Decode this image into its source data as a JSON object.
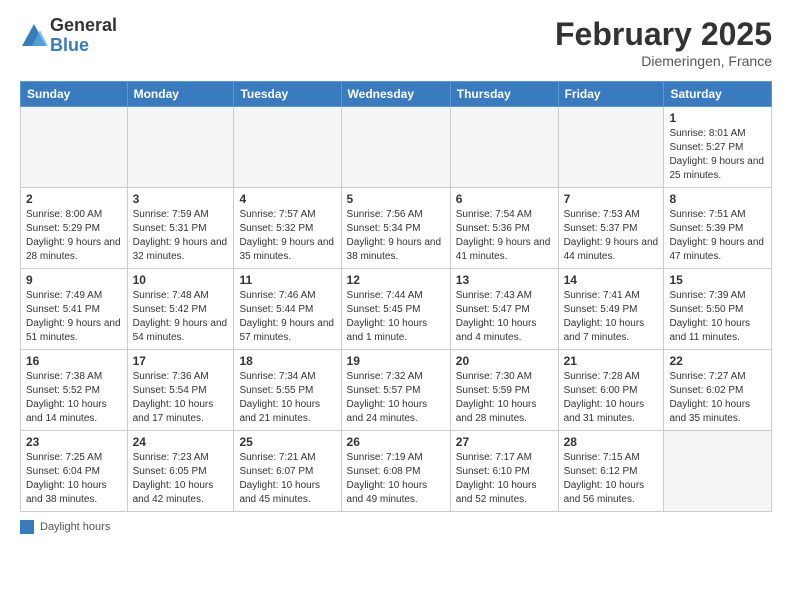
{
  "logo": {
    "general": "General",
    "blue": "Blue"
  },
  "title": "February 2025",
  "subtitle": "Diemeringen, France",
  "days_of_week": [
    "Sunday",
    "Monday",
    "Tuesday",
    "Wednesday",
    "Thursday",
    "Friday",
    "Saturday"
  ],
  "weeks": [
    [
      {
        "day": "",
        "info": ""
      },
      {
        "day": "",
        "info": ""
      },
      {
        "day": "",
        "info": ""
      },
      {
        "day": "",
        "info": ""
      },
      {
        "day": "",
        "info": ""
      },
      {
        "day": "",
        "info": ""
      },
      {
        "day": "1",
        "info": "Sunrise: 8:01 AM\nSunset: 5:27 PM\nDaylight: 9 hours and 25 minutes."
      }
    ],
    [
      {
        "day": "2",
        "info": "Sunrise: 8:00 AM\nSunset: 5:29 PM\nDaylight: 9 hours and 28 minutes."
      },
      {
        "day": "3",
        "info": "Sunrise: 7:59 AM\nSunset: 5:31 PM\nDaylight: 9 hours and 32 minutes."
      },
      {
        "day": "4",
        "info": "Sunrise: 7:57 AM\nSunset: 5:32 PM\nDaylight: 9 hours and 35 minutes."
      },
      {
        "day": "5",
        "info": "Sunrise: 7:56 AM\nSunset: 5:34 PM\nDaylight: 9 hours and 38 minutes."
      },
      {
        "day": "6",
        "info": "Sunrise: 7:54 AM\nSunset: 5:36 PM\nDaylight: 9 hours and 41 minutes."
      },
      {
        "day": "7",
        "info": "Sunrise: 7:53 AM\nSunset: 5:37 PM\nDaylight: 9 hours and 44 minutes."
      },
      {
        "day": "8",
        "info": "Sunrise: 7:51 AM\nSunset: 5:39 PM\nDaylight: 9 hours and 47 minutes."
      }
    ],
    [
      {
        "day": "9",
        "info": "Sunrise: 7:49 AM\nSunset: 5:41 PM\nDaylight: 9 hours and 51 minutes."
      },
      {
        "day": "10",
        "info": "Sunrise: 7:48 AM\nSunset: 5:42 PM\nDaylight: 9 hours and 54 minutes."
      },
      {
        "day": "11",
        "info": "Sunrise: 7:46 AM\nSunset: 5:44 PM\nDaylight: 9 hours and 57 minutes."
      },
      {
        "day": "12",
        "info": "Sunrise: 7:44 AM\nSunset: 5:45 PM\nDaylight: 10 hours and 1 minute."
      },
      {
        "day": "13",
        "info": "Sunrise: 7:43 AM\nSunset: 5:47 PM\nDaylight: 10 hours and 4 minutes."
      },
      {
        "day": "14",
        "info": "Sunrise: 7:41 AM\nSunset: 5:49 PM\nDaylight: 10 hours and 7 minutes."
      },
      {
        "day": "15",
        "info": "Sunrise: 7:39 AM\nSunset: 5:50 PM\nDaylight: 10 hours and 11 minutes."
      }
    ],
    [
      {
        "day": "16",
        "info": "Sunrise: 7:38 AM\nSunset: 5:52 PM\nDaylight: 10 hours and 14 minutes."
      },
      {
        "day": "17",
        "info": "Sunrise: 7:36 AM\nSunset: 5:54 PM\nDaylight: 10 hours and 17 minutes."
      },
      {
        "day": "18",
        "info": "Sunrise: 7:34 AM\nSunset: 5:55 PM\nDaylight: 10 hours and 21 minutes."
      },
      {
        "day": "19",
        "info": "Sunrise: 7:32 AM\nSunset: 5:57 PM\nDaylight: 10 hours and 24 minutes."
      },
      {
        "day": "20",
        "info": "Sunrise: 7:30 AM\nSunset: 5:59 PM\nDaylight: 10 hours and 28 minutes."
      },
      {
        "day": "21",
        "info": "Sunrise: 7:28 AM\nSunset: 6:00 PM\nDaylight: 10 hours and 31 minutes."
      },
      {
        "day": "22",
        "info": "Sunrise: 7:27 AM\nSunset: 6:02 PM\nDaylight: 10 hours and 35 minutes."
      }
    ],
    [
      {
        "day": "23",
        "info": "Sunrise: 7:25 AM\nSunset: 6:04 PM\nDaylight: 10 hours and 38 minutes."
      },
      {
        "day": "24",
        "info": "Sunrise: 7:23 AM\nSunset: 6:05 PM\nDaylight: 10 hours and 42 minutes."
      },
      {
        "day": "25",
        "info": "Sunrise: 7:21 AM\nSunset: 6:07 PM\nDaylight: 10 hours and 45 minutes."
      },
      {
        "day": "26",
        "info": "Sunrise: 7:19 AM\nSunset: 6:08 PM\nDaylight: 10 hours and 49 minutes."
      },
      {
        "day": "27",
        "info": "Sunrise: 7:17 AM\nSunset: 6:10 PM\nDaylight: 10 hours and 52 minutes."
      },
      {
        "day": "28",
        "info": "Sunrise: 7:15 AM\nSunset: 6:12 PM\nDaylight: 10 hours and 56 minutes."
      },
      {
        "day": "",
        "info": ""
      }
    ]
  ],
  "legend": {
    "color_label": "Daylight hours"
  }
}
